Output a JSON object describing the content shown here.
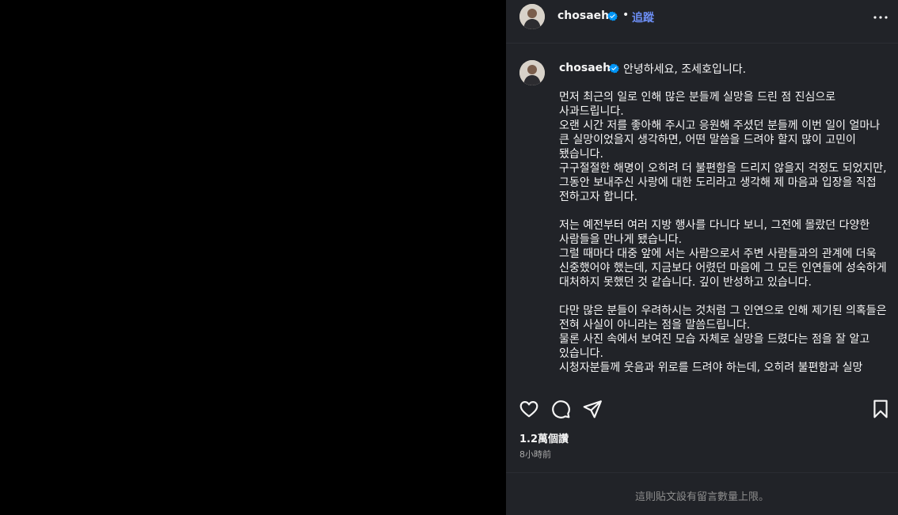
{
  "post": {
    "author": {
      "username": "chosaeho",
      "verified": true
    },
    "header": {
      "separator": "•",
      "follow_label": "追蹤",
      "more_icon": "more-horizontal-icon"
    },
    "caption": {
      "greeting": "안녕하세요, 조세호입니다.",
      "text": "먼저 최근의 일로 인해 많은 분들께 실망을 드린 점 진심으로 사과드립니다.\n오랜 시간 저를 좋아해 주시고 응원해 주셨던 분들께 이번 일이 얼마나 큰 실망이었을지 생각하면, 어떤 말씀을 드려야 할지 많이 고민이 됐습니다.\n구구절절한 해명이 오히려 더 불편함을 드리지 않을지 걱정도 되었지만, 그동안 보내주신 사랑에 대한 도리라고 생각해 제 마음과 입장을 직접 전하고자 합니다.\n\n저는 예전부터 여러 지방 행사를 다니다 보니, 그전에 몰랐던 다양한 사람들을 만나게 됐습니다.\n그럴 때마다 대중 앞에 서는 사람으로서 주변 사람들과의 관계에 더욱 신중했어야 했는데, 지금보다 어렸던 마음에 그 모든 인연들에 성숙하게 대처하지 못했던 것 같습니다. 깊이 반성하고 있습니다.\n\n다만 많은 분들이 우려하시는 것처럼 그 인연으로 인해 제기된 의혹들은 전혀 사실이 아니라는 점을 말씀드립니다.\n물론 사진 속에서 보여진 모습 자체로 실망을 드렸다는 점을 잘 알고 있습니다.\n시청자분들께 웃음과 위로를 드려야 하는데, 오히려 불편함과 실망"
    },
    "actions": {
      "like_icon": "heart-icon",
      "comment_icon": "comment-icon",
      "share_icon": "share-icon",
      "save_icon": "bookmark-icon"
    },
    "likes": "1.2萬個讚",
    "timestamp": "8小時前",
    "comments_notice": "這則貼文設有留言數量上限。"
  },
  "colors": {
    "panel_bg": "#212328",
    "follow_accent": "#6d8ff6",
    "verified_blue": "#0095f6",
    "muted_text": "#a8a8a8"
  }
}
